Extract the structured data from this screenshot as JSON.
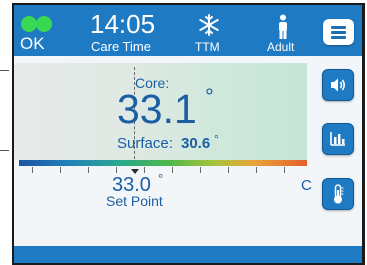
{
  "header": {
    "status_text": "OK",
    "time": "14:05",
    "time_label": "Care Time",
    "mode_icon": "snowflake-icon",
    "mode_label": "TTM",
    "patient_icon": "adult-person-icon",
    "patient_label": "Adult",
    "menu_icon": "hamburger-menu-icon",
    "status_color": "#38d84f",
    "accent": "#1f7ac4"
  },
  "temperature": {
    "core_label": "Core:",
    "core_value": "33.1",
    "core_degree": "°",
    "surface_label": "Surface:",
    "surface_value": "30.6",
    "surface_degree": "°",
    "setpoint_value": "33.0",
    "setpoint_degree": "°",
    "setpoint_label": "Set Point",
    "unit": "C",
    "text_color": "#1b5ea4"
  },
  "side_buttons": [
    {
      "icon": "speaker-volume-icon"
    },
    {
      "icon": "bar-chart-icon"
    },
    {
      "icon": "thermometer-icon"
    }
  ]
}
